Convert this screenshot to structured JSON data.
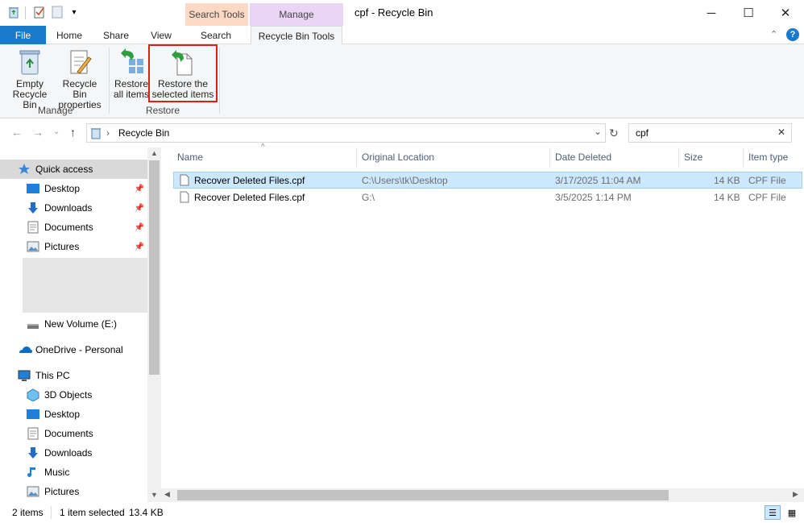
{
  "window": {
    "title": "cpf - Recycle Bin",
    "minimize": "─",
    "maximize": "☐",
    "close": "✕"
  },
  "context_tabs": {
    "search_tools": "Search Tools",
    "manage": "Manage"
  },
  "ribbon_tabs": {
    "file": "File",
    "home": "Home",
    "share": "Share",
    "view": "View",
    "search": "Search",
    "recycle_bin_tools": "Recycle Bin Tools"
  },
  "ribbon": {
    "empty_line1": "Empty",
    "empty_line2": "Recycle Bin",
    "props_line1": "Recycle Bin",
    "props_line2": "properties",
    "manage_group": "Manage",
    "restore_all_line1": "Restore",
    "restore_all_line2": "all items",
    "restore_sel_line1": "Restore the",
    "restore_sel_line2": "selected items",
    "restore_group": "Restore"
  },
  "address": {
    "location": "Recycle Bin",
    "search_value": "cpf"
  },
  "nav": {
    "quick_access": "Quick access",
    "desktop": "Desktop",
    "downloads": "Downloads",
    "documents": "Documents",
    "pictures": "Pictures",
    "new_volume": "New Volume (E:)",
    "onedrive": "OneDrive - Personal",
    "this_pc": "This PC",
    "objects_3d": "3D Objects",
    "pc_desktop": "Desktop",
    "pc_documents": "Documents",
    "pc_downloads": "Downloads",
    "music": "Music",
    "pc_pictures": "Pictures"
  },
  "columns": {
    "name": "Name",
    "original_location": "Original Location",
    "date_deleted": "Date Deleted",
    "size": "Size",
    "item_type": "Item type"
  },
  "files": [
    {
      "name": "Recover Deleted Files.cpf",
      "location": "C:\\Users\\tk\\Desktop",
      "date": "3/17/2025 11:04 AM",
      "size": "14 KB",
      "type": "CPF File"
    },
    {
      "name": "Recover Deleted Files.cpf",
      "location": "G:\\",
      "date": "3/5/2025 1:14 PM",
      "size": "14 KB",
      "type": "CPF File"
    }
  ],
  "status": {
    "items": "2 items",
    "selected": "1 item selected",
    "size": "13.4 KB"
  },
  "colors": {
    "accent": "#1979ca",
    "selection": "#cce8ff",
    "highlight_border": "#e21b1b"
  }
}
